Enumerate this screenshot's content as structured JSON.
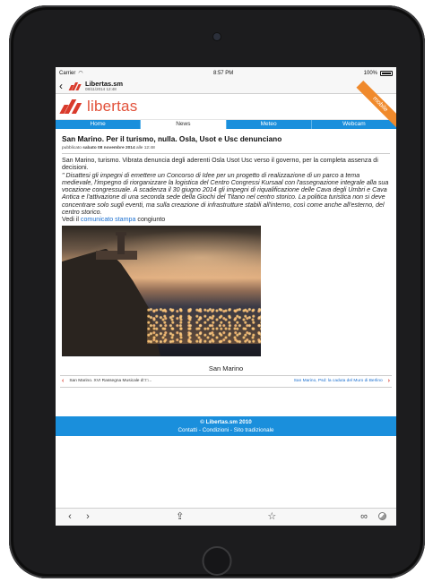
{
  "status": {
    "carrier": "Carrier",
    "time": "8:57 PM",
    "battery": "100%"
  },
  "nav": {
    "back_icon": "chevron-left-icon",
    "title": "Libertas.sm",
    "subtitle": "08/11/2014 12:48"
  },
  "site": {
    "logo_text": "libertas",
    "ribbon": "mobile",
    "brand_color": "#e2513a",
    "accent_color": "#1a8fdc"
  },
  "tabs": [
    {
      "label": "Home",
      "active": false
    },
    {
      "label": "News",
      "active": true
    },
    {
      "label": "Meteo",
      "active": false
    },
    {
      "label": "Webcam",
      "active": false
    }
  ],
  "article": {
    "headline": "San Marino. Per il turismo, nulla. Osla, Usot e Usc denunciano",
    "meta_prefix": "pubblicato",
    "meta_date": "sabato 08 novembre 2014",
    "meta_time": "alle 12:48",
    "intro": "San Marino, turismo. Vibrata denuncia degli aderenti Osla Usot Usc verso  il governo, per la completa assenza di decisioni.",
    "quote": "\" Disattesi gli impegni di emettere un Concorso di Idee per un progetto di realizzazione di un parco a tema medievale, l'impegno di riorganizzare la logistica del Centro Congressi Kursaal con l'assegnazione integrale alla sua vocazione congressuale. A scadenza il 30 giugno 2014 gli impegni di riqualificazione delle Cava degli Umbri e Cava Antica e l'attivazione di una seconda sede della Giochi del Titano nel centro storico. La politica turistica non si deve concentrare solo sugli eventi, ma sulla creazione di infrastrutture stabili all'interno, così come anche all'esterno, del centro storico.",
    "see_prefix": "Vedi il",
    "see_link": "comunicato stampa",
    "see_suffix": "congiunto",
    "photo_caption": "San Marino"
  },
  "related": {
    "prev": "San Marino. XVI Rassegna Musicale d□□...",
    "next": "San Marino, Psd: la caduta del Muro di Berlino"
  },
  "footer": {
    "copyright": "© Libertas.sm 2010",
    "links": "Contatti - Condizioni - Sito tradizionale"
  },
  "toolbar": {
    "icons": [
      "back-icon",
      "forward-icon",
      "share-icon",
      "bookmark-star-icon",
      "reader-glasses-icon",
      "settings-dial-icon"
    ]
  }
}
